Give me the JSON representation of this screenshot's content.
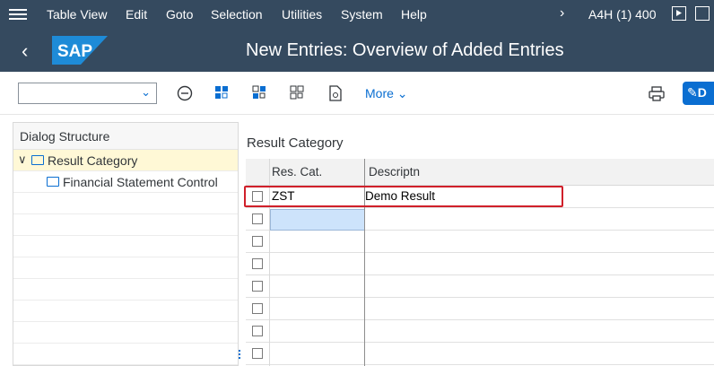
{
  "menubar": {
    "items": [
      "Table View",
      "Edit",
      "Goto",
      "Selection",
      "Utilities",
      "System",
      "Help"
    ],
    "system_info": "A4H (1) 400"
  },
  "titlebar": {
    "logo_text": "SAP",
    "title": "New Entries: Overview of Added Entries"
  },
  "toolbar": {
    "more_label": "More",
    "display_btn_label": "D"
  },
  "left_panel": {
    "header": "Dialog Structure",
    "tree": [
      {
        "label": "Result Category",
        "selected": true
      },
      {
        "label": "Financial Statement Control",
        "selected": false
      }
    ]
  },
  "main": {
    "section_title": "Result Category",
    "columns": [
      "Res. Cat.",
      "Descriptn"
    ],
    "rows": [
      {
        "res_cat": "ZST",
        "description": "Demo Result"
      },
      {
        "res_cat": "",
        "description": ""
      },
      {
        "res_cat": "",
        "description": ""
      },
      {
        "res_cat": "",
        "description": ""
      },
      {
        "res_cat": "",
        "description": ""
      },
      {
        "res_cat": "",
        "description": ""
      },
      {
        "res_cat": "",
        "description": ""
      },
      {
        "res_cat": "",
        "description": ""
      }
    ]
  },
  "colors": {
    "shell": "#354a5f",
    "accent": "#0a6ed1",
    "highlight_box": "#d0202a",
    "selected_tree": "#fff8d6"
  }
}
